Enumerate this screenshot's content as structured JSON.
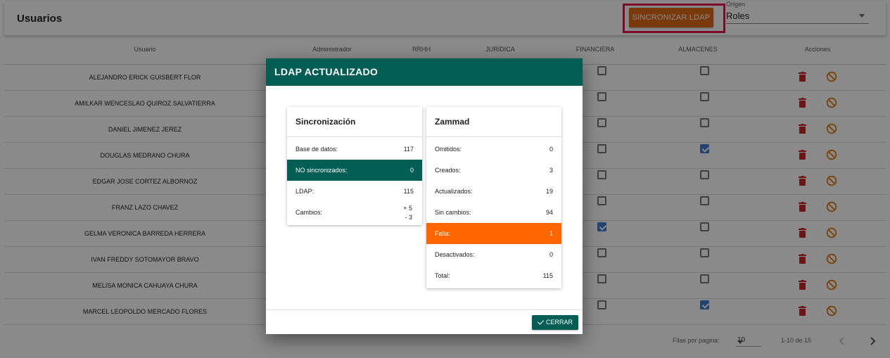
{
  "toolbar": {
    "title": "Usuarios",
    "sync_button": "SINCRONIZAR LDAP",
    "origin_label": "Origen",
    "origin_value": "Roles"
  },
  "table": {
    "headers": [
      "Usuario",
      "Administrador",
      "RRHH",
      "JURIDICA",
      "FINANCIERA",
      "ALMACENES",
      "Acciones"
    ],
    "rows": [
      {
        "name": "ALEJANDRO ERICK GUISBERT FLOR",
        "financiera": false,
        "almacenes": false
      },
      {
        "name": "AMILKAR WENCESLAO QUIROZ SALVATIERRA",
        "financiera": false,
        "almacenes": false
      },
      {
        "name": "DANIEL JIMENEZ JEREZ",
        "financiera": false,
        "almacenes": false
      },
      {
        "name": "DOUGLAS MEDRANO CHURA",
        "financiera": false,
        "almacenes": true
      },
      {
        "name": "EDGAR JOSE CORTEZ ALBORNOZ",
        "financiera": false,
        "almacenes": false
      },
      {
        "name": "FRANZ LAZO CHAVEZ",
        "financiera": false,
        "almacenes": false
      },
      {
        "name": "GELMA VERONICA BARREDA HERRERA",
        "financiera": true,
        "almacenes": false
      },
      {
        "name": "IVAN FREDDY SOTOMAYOR BRAVO",
        "financiera": false,
        "almacenes": false
      },
      {
        "name": "MELISA MONICA CAHUAYA CHURA",
        "financiera": false,
        "almacenes": false
      },
      {
        "name": "MARCEL LEOPOLDO MERCADO FLORES",
        "financiera": false,
        "almacenes": true
      }
    ]
  },
  "pagination": {
    "rows_per_page_label": "Filas por pagina:",
    "rows_per_page": "10",
    "range": "1-10 de 15"
  },
  "dialog": {
    "title": "LDAP ACTUALIZADO",
    "sync_card": {
      "title": "Sincronización",
      "rows": [
        {
          "label": "Base de datos:",
          "value": "117"
        },
        {
          "label": "NO sincronizados:",
          "value": "0"
        },
        {
          "label": "LDAP:",
          "value": "115"
        }
      ],
      "changes_label": "Cambios:",
      "changes_added": "+ 5",
      "changes_removed": "- 3"
    },
    "zammad_card": {
      "title": "Zammad",
      "rows": [
        {
          "label": "Omitidos:",
          "value": "0"
        },
        {
          "label": "Creados:",
          "value": "3"
        },
        {
          "label": "Actualizados:",
          "value": "19"
        },
        {
          "label": "Sin cambios:",
          "value": "94"
        },
        {
          "label": "Falla:",
          "value": "1"
        },
        {
          "label": "Desactivados:",
          "value": "0"
        },
        {
          "label": "Total:",
          "value": "115"
        }
      ]
    },
    "close_button": "CERRAR"
  },
  "colors": {
    "primary": "#025e55",
    "sync_button": "#e06a16",
    "highlight_border": "#e8124b",
    "failure": "#ff6600",
    "delete_icon": "#c62828",
    "block_icon": "#e07a10",
    "checkbox_checked": "#3f7fd0"
  },
  "icons": {
    "row_delete": "trash-icon",
    "row_block": "block-icon",
    "select_caret": "caret-down-icon",
    "prev": "chevron-left-icon",
    "next": "chevron-right-icon",
    "close": "check-icon"
  }
}
